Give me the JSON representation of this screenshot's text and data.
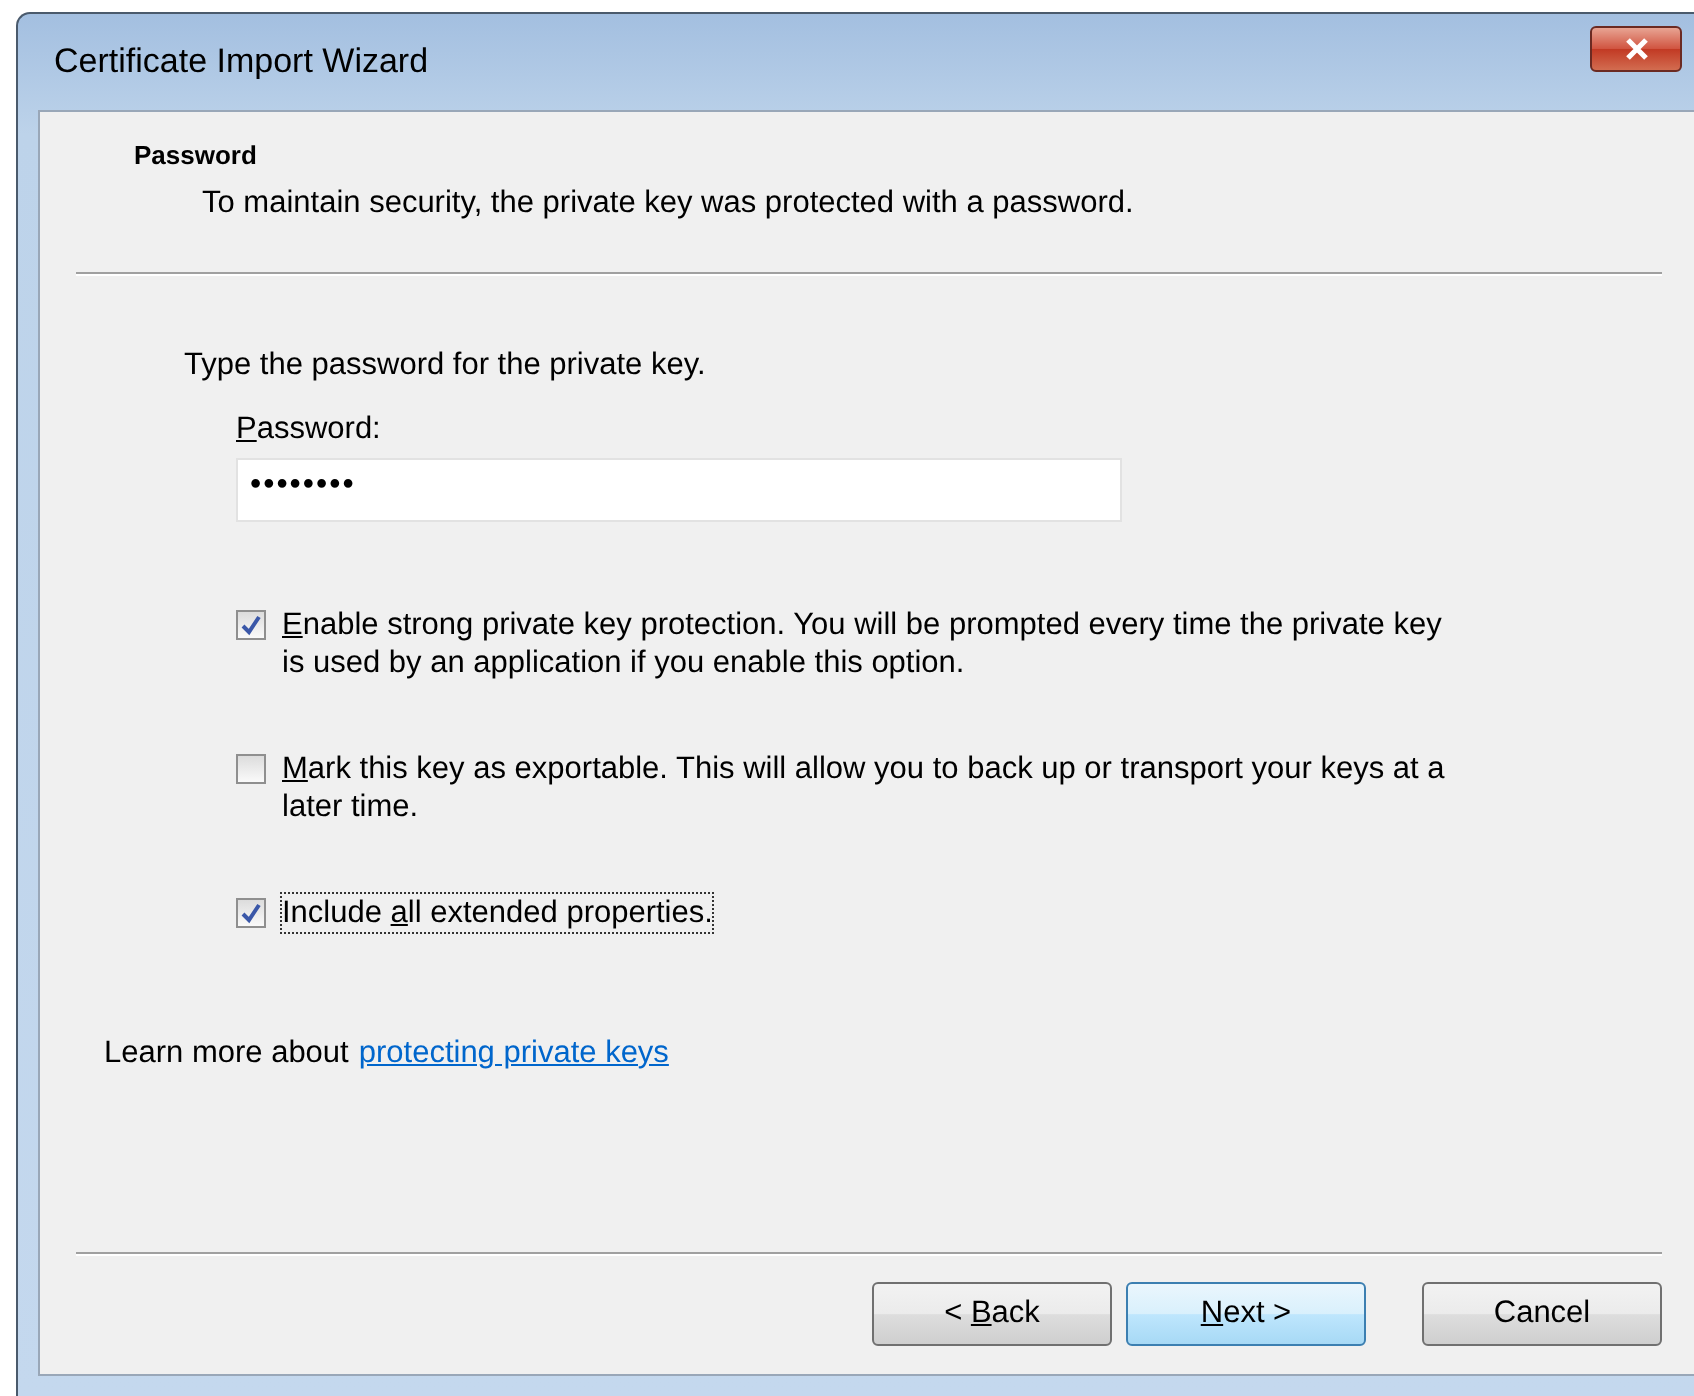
{
  "window": {
    "title": "Certificate Import Wizard"
  },
  "header": {
    "title": "Password",
    "subtitle": "To maintain security, the private key was protected with a password."
  },
  "prompt": "Type the password for the private key.",
  "password": {
    "label": {
      "key": "P",
      "after": "assword:"
    },
    "value": "••••••••"
  },
  "options": [
    {
      "label": {
        "key": "E",
        "after": "nable strong private key protection. You will be prompted every time the private key is used by an application if you enable this option."
      },
      "checked": true,
      "focused": false
    },
    {
      "label": {
        "key": "M",
        "after": "ark this key as exportable. This will allow you to back up or transport your keys at a later time."
      },
      "checked": false,
      "focused": false
    },
    {
      "label": {
        "before": "Include ",
        "key": "a",
        "after": "ll extended properties."
      },
      "checked": true,
      "focused": true
    }
  ],
  "learn_more": {
    "text": "Learn more about",
    "link": "protecting private keys"
  },
  "buttons": [
    {
      "label": {
        "before": "< ",
        "key": "B",
        "after": "ack"
      },
      "default": false
    },
    {
      "label": {
        "key": "N",
        "after": "ext >"
      },
      "default": true
    },
    {
      "label": {
        "before": "Cancel"
      },
      "default": false
    }
  ]
}
